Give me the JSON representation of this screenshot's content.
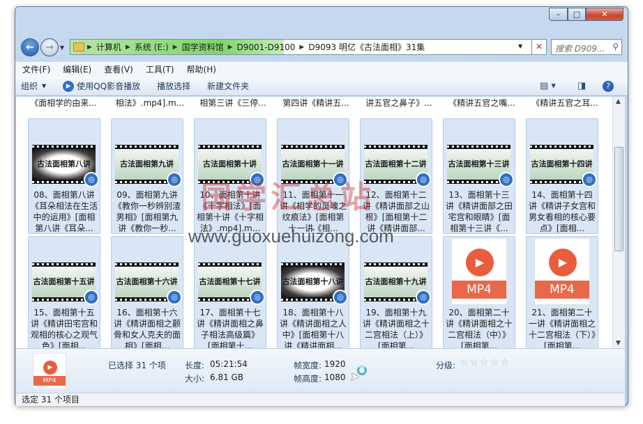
{
  "titlebar": {
    "min": "–",
    "max": "□",
    "close": "✕"
  },
  "nav": {
    "back": "←",
    "forward": "→",
    "recent": "▼"
  },
  "address": {
    "crumbs": [
      "计算机",
      "系统 (E:)",
      "国学资料馆",
      "D9001-D9100",
      "D9093 明亿《古法面相》31集"
    ],
    "dropdown": "▼",
    "clear": "✕"
  },
  "search": {
    "placeholder": "搜索 D909...",
    "icon": "search-icon"
  },
  "menubar": [
    "文件(F)",
    "编辑(E)",
    "查看(V)",
    "工具(T)",
    "帮助(H)"
  ],
  "toolbar": {
    "organize": "组织",
    "play_qq": "使用QQ影音播放",
    "play_selection": "播放选择",
    "new_folder": "新建文件夹"
  },
  "top_partial": [
    "《面相学的由来...",
    "相法》.mp4].m...",
    "相第三讲《三停...",
    "第四讲《精讲五...",
    "讲五官之鼻子》...",
    "《精讲五官之嘴...",
    "《精讲五官之耳..."
  ],
  "row1": [
    {
      "thumb": "古法面相第八讲",
      "label": "08、面相第八讲《耳朵相法在生活中的运用》[面相第八讲《耳朵...",
      "dark": true
    },
    {
      "thumb": "古法面相第九讲",
      "label": "09、面相第九讲《教你一秒辨别渣男相》[面相第九讲《教你一秒...",
      "dark": false
    },
    {
      "thumb": "古法面相第十讲",
      "label": "10、面相第十讲《十字相法》[面相第十讲《十字相法》.mp4].m...",
      "dark": false
    },
    {
      "thumb": "古法面相第十一讲",
      "label": "11、面相第十一讲《相学的灵魂之纹痕法》[面相第十一讲《相...",
      "dark": false
    },
    {
      "thumb": "古法面相第十二讲",
      "label": "12、面相第十二讲《精讲面部之山根》[面相第十二讲《精讲面部...",
      "dark": false
    },
    {
      "thumb": "古法面相第十三讲",
      "label": "13、面相第十三讲《精讲面部之田宅宫和眼睛》[面相第十三讲《...",
      "dark": false
    },
    {
      "thumb": "古法面相第十四讲",
      "label": "14、面相第十四讲《精讲子女宫和男女看相的核心要点》[面相...",
      "dark": false
    }
  ],
  "row2": [
    {
      "thumb": "古法面相第十五讲",
      "label": "15、面相第十五讲《精讲田宅宫和观相的核心之观气色》[面相...",
      "dark": false,
      "mp4": false
    },
    {
      "thumb": "古法面相第十六讲",
      "label": "16、面相第十六讲《精讲面相之颧骨和女人克夫的面相》[面相...",
      "dark": false,
      "mp4": false
    },
    {
      "thumb": "古法面相第十七讲",
      "label": "17、面相第十七讲《精讲面相之鼻子相法高级篇》[面相第十...",
      "dark": false,
      "mp4": false
    },
    {
      "thumb": "古法面相第十八讲",
      "label": "18、面相第十八讲《精讲面相之人中》[面相第十八讲《精讲面相...",
      "dark": true,
      "mp4": false
    },
    {
      "thumb": "古法面相第十九讲",
      "label": "19、面相第十九讲《精讲面相之十二宫相法（上）》[面相第...",
      "dark": false,
      "mp4": false
    },
    {
      "thumb": "MP4",
      "label": "20、面相第二十讲《精讲面相之十二宫相法（中）》[面相第...",
      "dark": false,
      "mp4": true
    },
    {
      "thumb": "MP4",
      "label": "21、面相第二十一讲《精讲面相之十二宫相法（下）》[面相第...",
      "dark": false,
      "mp4": true
    }
  ],
  "details": {
    "selected": "已选择 31 个项",
    "length_label": "长度:",
    "length": "05:21:54",
    "size_label": "大小:",
    "size": "6.81 GB",
    "width_label": "帧宽度:",
    "width": "1920",
    "height_label": "帧高度:",
    "height": "1080",
    "rating_label": "分级:",
    "stars": "☆☆☆☆☆",
    "icon_label": "MP4"
  },
  "watermark": {
    "text": "国学汇总站",
    "url": "www.guoxuehuizong.com"
  },
  "status": "选定 31 个项目"
}
